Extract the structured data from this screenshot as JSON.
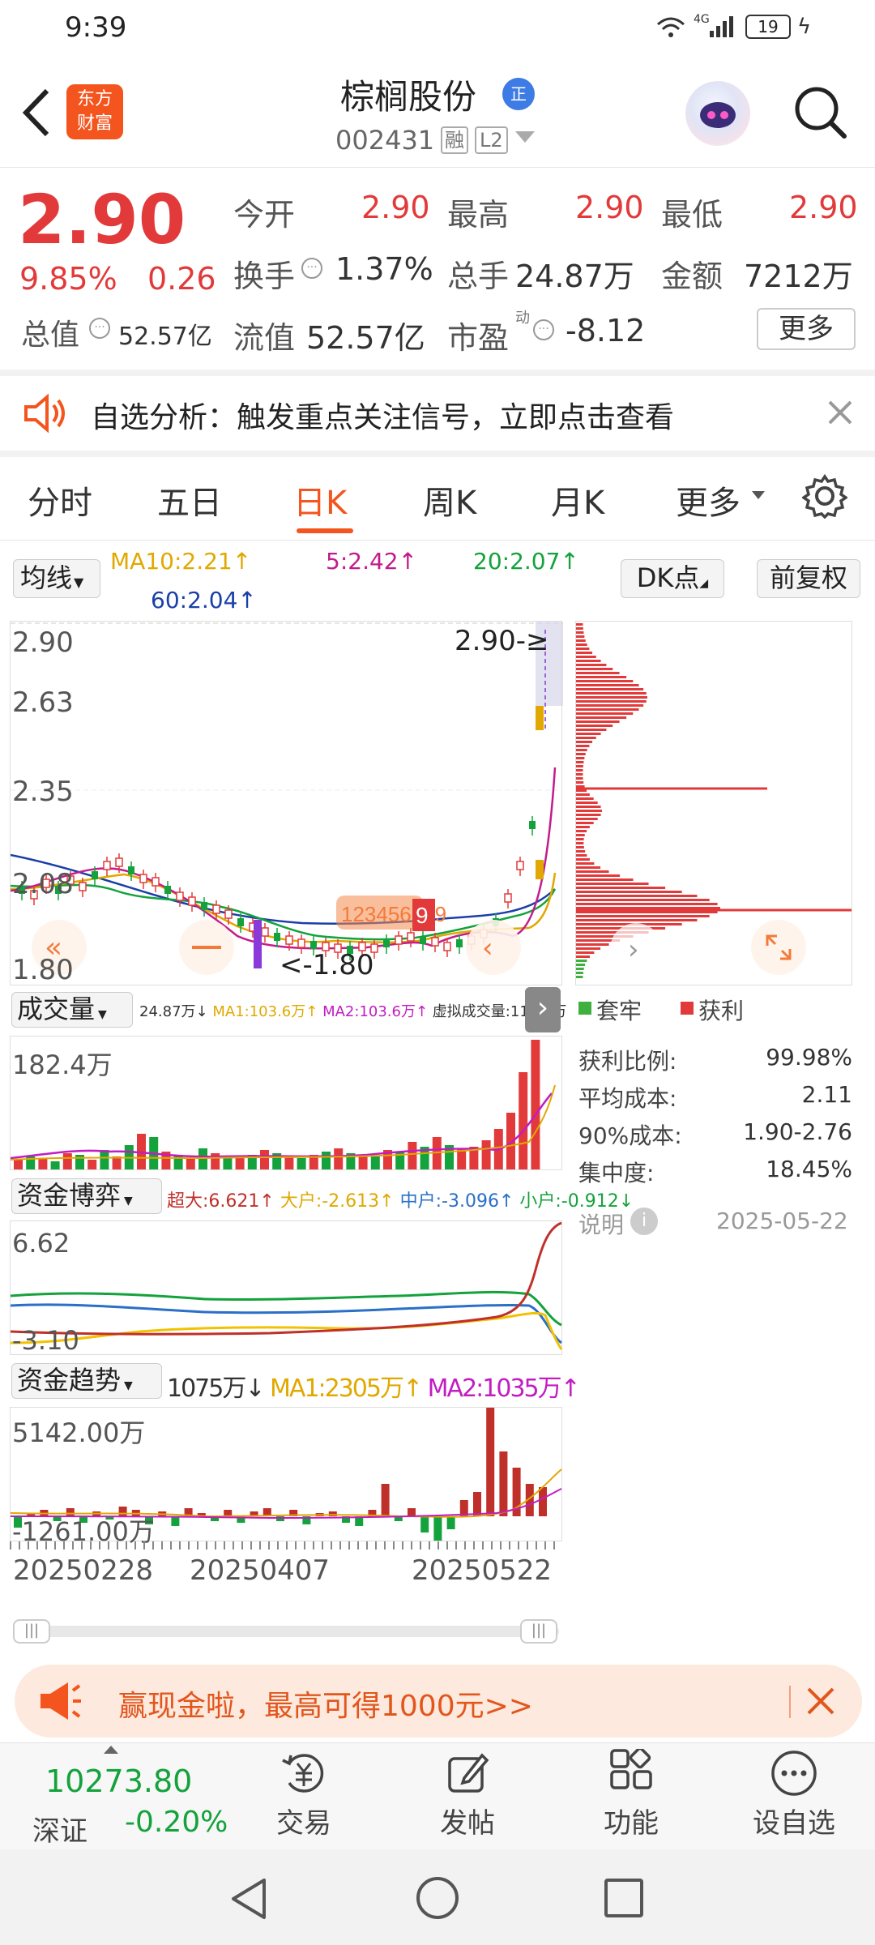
{
  "status_bar": {
    "time": "9:39",
    "network": "4G",
    "battery": "19"
  },
  "header": {
    "app_logo_line1": "东方",
    "app_logo_line2": "财富",
    "stock_name": "棕榈股份",
    "stock_code": "002431",
    "tag_margin": "融",
    "tag_level": "L2"
  },
  "quote": {
    "price": "2.90",
    "change_pct": "9.85%",
    "change_amt": "0.26",
    "open_label": "今开",
    "open": "2.90",
    "high_label": "最高",
    "high": "2.90",
    "low_label": "最低",
    "low": "2.90",
    "turnover_label": "换手",
    "turnover": "1.37%",
    "volume_label": "总手",
    "volume": "24.87万",
    "amount_label": "金额",
    "amount": "7212万",
    "mktcap_label": "总值",
    "mktcap": "52.57亿",
    "float_label": "流值",
    "float": "52.57亿",
    "pe_label": "市盈",
    "pe_sup": "动",
    "pe": "-8.12",
    "more_label": "更多"
  },
  "notice": {
    "text": "自选分析：触发重点关注信号，立即点击查看"
  },
  "tabs": [
    {
      "label": "分时"
    },
    {
      "label": "五日"
    },
    {
      "label": "日K"
    },
    {
      "label": "周K"
    },
    {
      "label": "月K"
    },
    {
      "label": "更多"
    }
  ],
  "ma": {
    "select": "均线",
    "ma10": "MA10:2.21↑",
    "ma5": "5:2.42↑",
    "ma20": "20:2.07↑",
    "ma60": "60:2.04↑",
    "dk": "DK点",
    "fuquan": "前复权"
  },
  "kline": {
    "y_labels": [
      "2.90",
      "2.63",
      "2.35",
      "2.08",
      "1.80"
    ],
    "top_marker": "2.90-≥",
    "low_marker": "<-1.80",
    "signal_text": "123456789",
    "signal_last": "9"
  },
  "volume": {
    "select": "成交量",
    "info": [
      {
        "t": "24.87万↓",
        "c": "#333"
      },
      {
        "t": "MA1:103.6万↑",
        "c": "#e0a800"
      },
      {
        "t": "MA2:103.6万↑",
        "c": "#c21cc2"
      },
      {
        "t": "虚拟成交量:118.1万",
        "c": "#333"
      }
    ],
    "max": "182.4万"
  },
  "fund_game": {
    "select": "资金博弈",
    "info": [
      {
        "t": "超大:6.621↑",
        "c": "#c0302b"
      },
      {
        "t": "大户:-2.613↑",
        "c": "#e0a800"
      },
      {
        "t": "中户:-3.096↑",
        "c": "#2a6fc8"
      },
      {
        "t": "小户:-0.912↓",
        "c": "#14a23c"
      }
    ],
    "max": "6.62",
    "min": "-3.10"
  },
  "fund_trend": {
    "select": "资金趋势",
    "info": [
      {
        "t": "1075万↓",
        "c": "#333"
      },
      {
        "t": "MA1:2305万↑",
        "c": "#e0a800"
      },
      {
        "t": "MA2:1035万↑",
        "c": "#c21cc2"
      }
    ],
    "max": "5142.00万",
    "min": "-1261.00万"
  },
  "dates": [
    "20250228",
    "20250407",
    "20250522"
  ],
  "chip_panel": {
    "legend_trapped": "套牢",
    "legend_profit": "获利",
    "rows": [
      {
        "k": "获利比例:",
        "v": "99.98%"
      },
      {
        "k": "平均成本:",
        "v": "2.11"
      },
      {
        "k": "90%成本:",
        "v": "1.90-2.76"
      },
      {
        "k": "集中度:",
        "v": "18.45%"
      }
    ],
    "note": "说明",
    "date": "2025-05-22"
  },
  "ad": {
    "text": "赢现金啦，最高可得1000元>>"
  },
  "bottom": {
    "index_value": "10273.80",
    "index_name": "深证",
    "index_change": "-0.20%",
    "items": [
      {
        "label": "交易"
      },
      {
        "label": "发帖"
      },
      {
        "label": "功能"
      },
      {
        "label": "设自选"
      }
    ]
  }
}
